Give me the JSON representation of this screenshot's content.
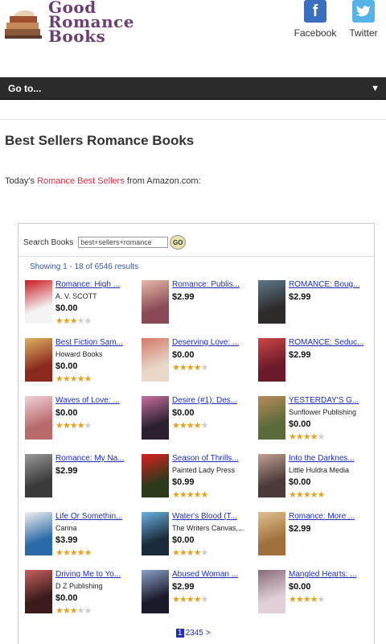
{
  "header": {
    "logo_lines": [
      "Good",
      "Romance",
      "Books"
    ],
    "facebook_label": "Facebook",
    "twitter_label": "Twitter"
  },
  "nav": {
    "goto_label": "Go to...",
    "arrow": "▼"
  },
  "page": {
    "title": "Best Sellers Romance Books",
    "intro_prefix": "Today's",
    "intro_link": "Romance Best Sellers",
    "intro_suffix": "from Amazon.com:"
  },
  "widget": {
    "search_label": "Search Books",
    "search_value": "best+sellers+romance",
    "go_label": "GO",
    "results_text": "Showing 1 - 18 of 6546 results",
    "pager": {
      "current": "1",
      "pages": [
        "2",
        "3",
        "4",
        "5"
      ],
      "next": ">"
    },
    "books": [
      {
        "title": "Romance: High ...",
        "author": "A. V. SCOTT",
        "price": "$0.00",
        "rating": 3,
        "cover_color": "#f4f4f4",
        "accent": "#c8191f"
      },
      {
        "title": "Romance: Publis...",
        "author": "",
        "price": "$2.99",
        "rating": 0,
        "cover_color": "#8a4a55",
        "accent": "#e7b8a8"
      },
      {
        "title": "ROMANCE: Boug...",
        "author": "",
        "price": "$2.99",
        "rating": 0,
        "cover_color": "#2e2a2a",
        "accent": "#5d7a8a"
      },
      {
        "title": "Best Fiction Sam...",
        "author": "Howard Books",
        "price": "$0.00",
        "rating": 5,
        "cover_color": "#8a2a1e",
        "accent": "#e0b060"
      },
      {
        "title": "Deserving Love: ...",
        "author": "",
        "price": "$0.00",
        "rating": 4,
        "cover_color": "#e9d8c8",
        "accent": "#d4786a"
      },
      {
        "title": "ROMANCE: Seduc...",
        "author": "",
        "price": "$2.99",
        "rating": 0,
        "cover_color": "#6a1a2a",
        "accent": "#c44"
      },
      {
        "title": "Waves of Love: ...",
        "author": "",
        "price": "$0.00",
        "rating": 4,
        "cover_color": "#b86a6a",
        "accent": "#f0d0d8"
      },
      {
        "title": "Desire (#1): Des...",
        "author": "",
        "price": "$0.00",
        "rating": 4,
        "cover_color": "#2a1f2f",
        "accent": "#c86fa0"
      },
      {
        "title": "YESTERDAY'S G...",
        "author": "Sunflower Publishing",
        "price": "$0.00",
        "rating": 4,
        "cover_color": "#5a6a3a",
        "accent": "#b88a5a"
      },
      {
        "title": "Romance: My Na...",
        "author": "",
        "price": "$2.99",
        "rating": 0,
        "cover_color": "#3a3a3a",
        "accent": "#999"
      },
      {
        "title": "Season of Thrills...",
        "author": "Painted Lady Press",
        "price": "$0.99",
        "rating": 5,
        "cover_color": "#2a3a1a",
        "accent": "#d82020"
      },
      {
        "title": "Into the Darknes...",
        "author": "Little Huldra Media",
        "price": "$0.00",
        "rating": 5,
        "cover_color": "#4a3a3a",
        "accent": "#c0a090"
      },
      {
        "title": "Life Or Somethin...",
        "author": "Carina",
        "price": "$3.99",
        "rating": 5,
        "cover_color": "#2a6aa8",
        "accent": "#f0f0f0"
      },
      {
        "title": "Water's Blood (T...",
        "author": "The Writers Canvas,...",
        "price": "$0.00",
        "rating": 4,
        "cover_color": "#1a2a3a",
        "accent": "#6ab0e0"
      },
      {
        "title": "Romance: More ...",
        "author": "",
        "price": "$2.99",
        "rating": 0,
        "cover_color": "#a0703a",
        "accent": "#e0c090"
      },
      {
        "title": "Driving Me to Yo...",
        "author": "D Z Publishing",
        "price": "$0.00",
        "rating": 3,
        "cover_color": "#3a1a1a",
        "accent": "#c86060"
      },
      {
        "title": "Abused Woman ...",
        "author": "",
        "price": "$2.99",
        "rating": 4,
        "cover_color": "#1a1a2a",
        "accent": "#8aa0c8"
      },
      {
        "title": "Mangled Hearts: ...",
        "author": "",
        "price": "$0.00",
        "rating": 4,
        "cover_color": "#e0d0d8",
        "accent": "#8a6a7a"
      }
    ]
  }
}
